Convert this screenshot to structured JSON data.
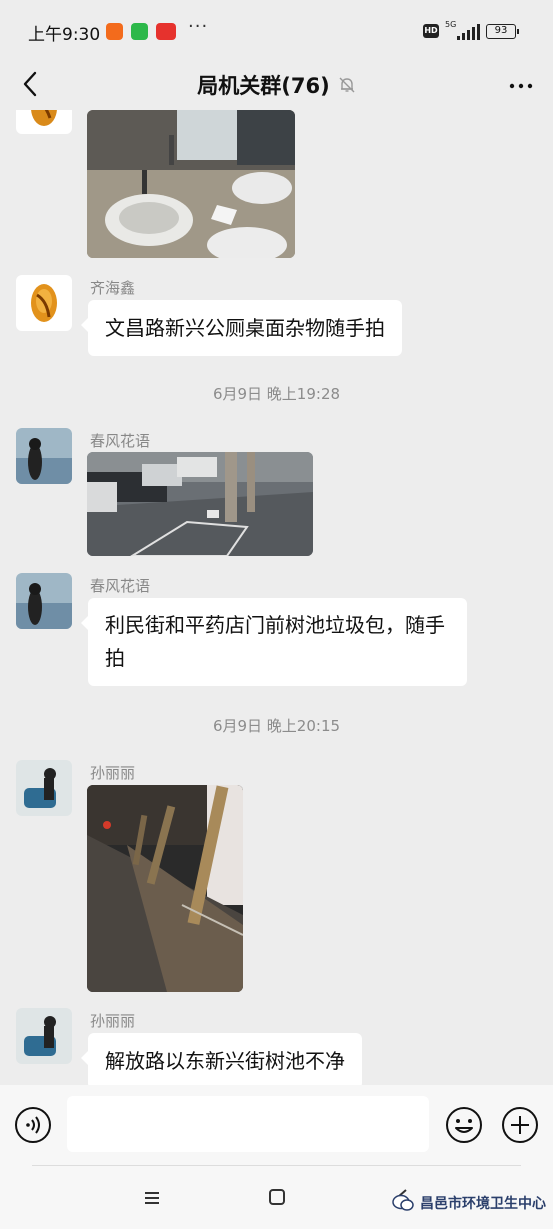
{
  "status_bar": {
    "time": "上午9:30",
    "dots": "···",
    "hd": "HD",
    "network": "5G",
    "battery": "93"
  },
  "header": {
    "title": "局机关群(76)"
  },
  "messages": [
    {
      "sender": "齐海鑫",
      "text": "文昌路新兴公厕桌面杂物随手拍"
    },
    {
      "timestamp": "6月9日 晚上19:28"
    },
    {
      "sender": "春风花语",
      "type": "image"
    },
    {
      "sender": "春风花语",
      "text": "利民街和平药店门前树池垃圾包，随手拍"
    },
    {
      "timestamp": "6月9日 晚上20:15"
    },
    {
      "sender": "孙丽丽",
      "type": "image"
    },
    {
      "sender": "孙丽丽",
      "text": "解放路以东新兴街树池不净"
    }
  ],
  "input_bar": {
    "placeholder": ""
  },
  "watermark": "昌邑市环境卫生中心",
  "icons": [
    "back-arrow-icon",
    "mute-bell-icon",
    "more-icon",
    "voice-icon",
    "emoji-icon",
    "plus-icon",
    "menu-icon",
    "home-icon",
    "back-nav-icon"
  ]
}
